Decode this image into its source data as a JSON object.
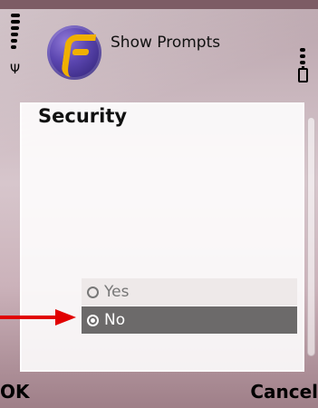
{
  "header": {
    "title": "Show Prompts"
  },
  "content": {
    "title": "Security"
  },
  "options": [
    {
      "label": "Yes",
      "selected": false
    },
    {
      "label": "No",
      "selected": true
    }
  ],
  "softkeys": {
    "left": "OK",
    "right": "Cancel"
  },
  "colors": {
    "arrow": "#e10000",
    "selected": "#6c6a6a"
  },
  "icons": {
    "app": "application-icon",
    "signal": "signal-icon",
    "battery": "battery-icon",
    "arrow": "pointer-arrow-icon"
  }
}
